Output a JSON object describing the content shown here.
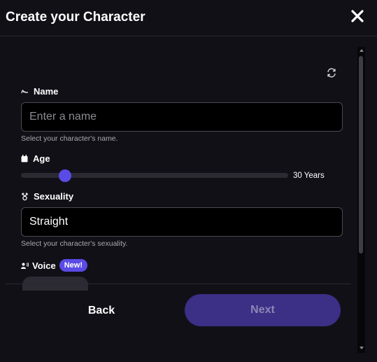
{
  "dialog": {
    "title": "Create your Character",
    "close_icon": "close-icon"
  },
  "form": {
    "refresh_icon": "refresh-icon",
    "name": {
      "label": "Name",
      "icon": "signature-icon",
      "value": "",
      "placeholder": "Enter a name",
      "helper": "Select your character's name."
    },
    "age": {
      "label": "Age",
      "icon": "calendar-icon",
      "value": 30,
      "min": 18,
      "max": 99,
      "value_label": "30 Years"
    },
    "sexuality": {
      "label": "Sexuality",
      "icon": "gender-icon",
      "value": "Straight",
      "helper": "Select your character's sexuality."
    },
    "voice": {
      "label": "Voice",
      "icon": "voice-icon",
      "badge": "New!"
    }
  },
  "footer": {
    "back_label": "Back",
    "next_label": "Next"
  },
  "colors": {
    "background": "#111017",
    "accent": "#5a4be6",
    "next_disabled": "#3b2f86",
    "input_bg": "#000000",
    "input_border": "#4a4a52"
  }
}
